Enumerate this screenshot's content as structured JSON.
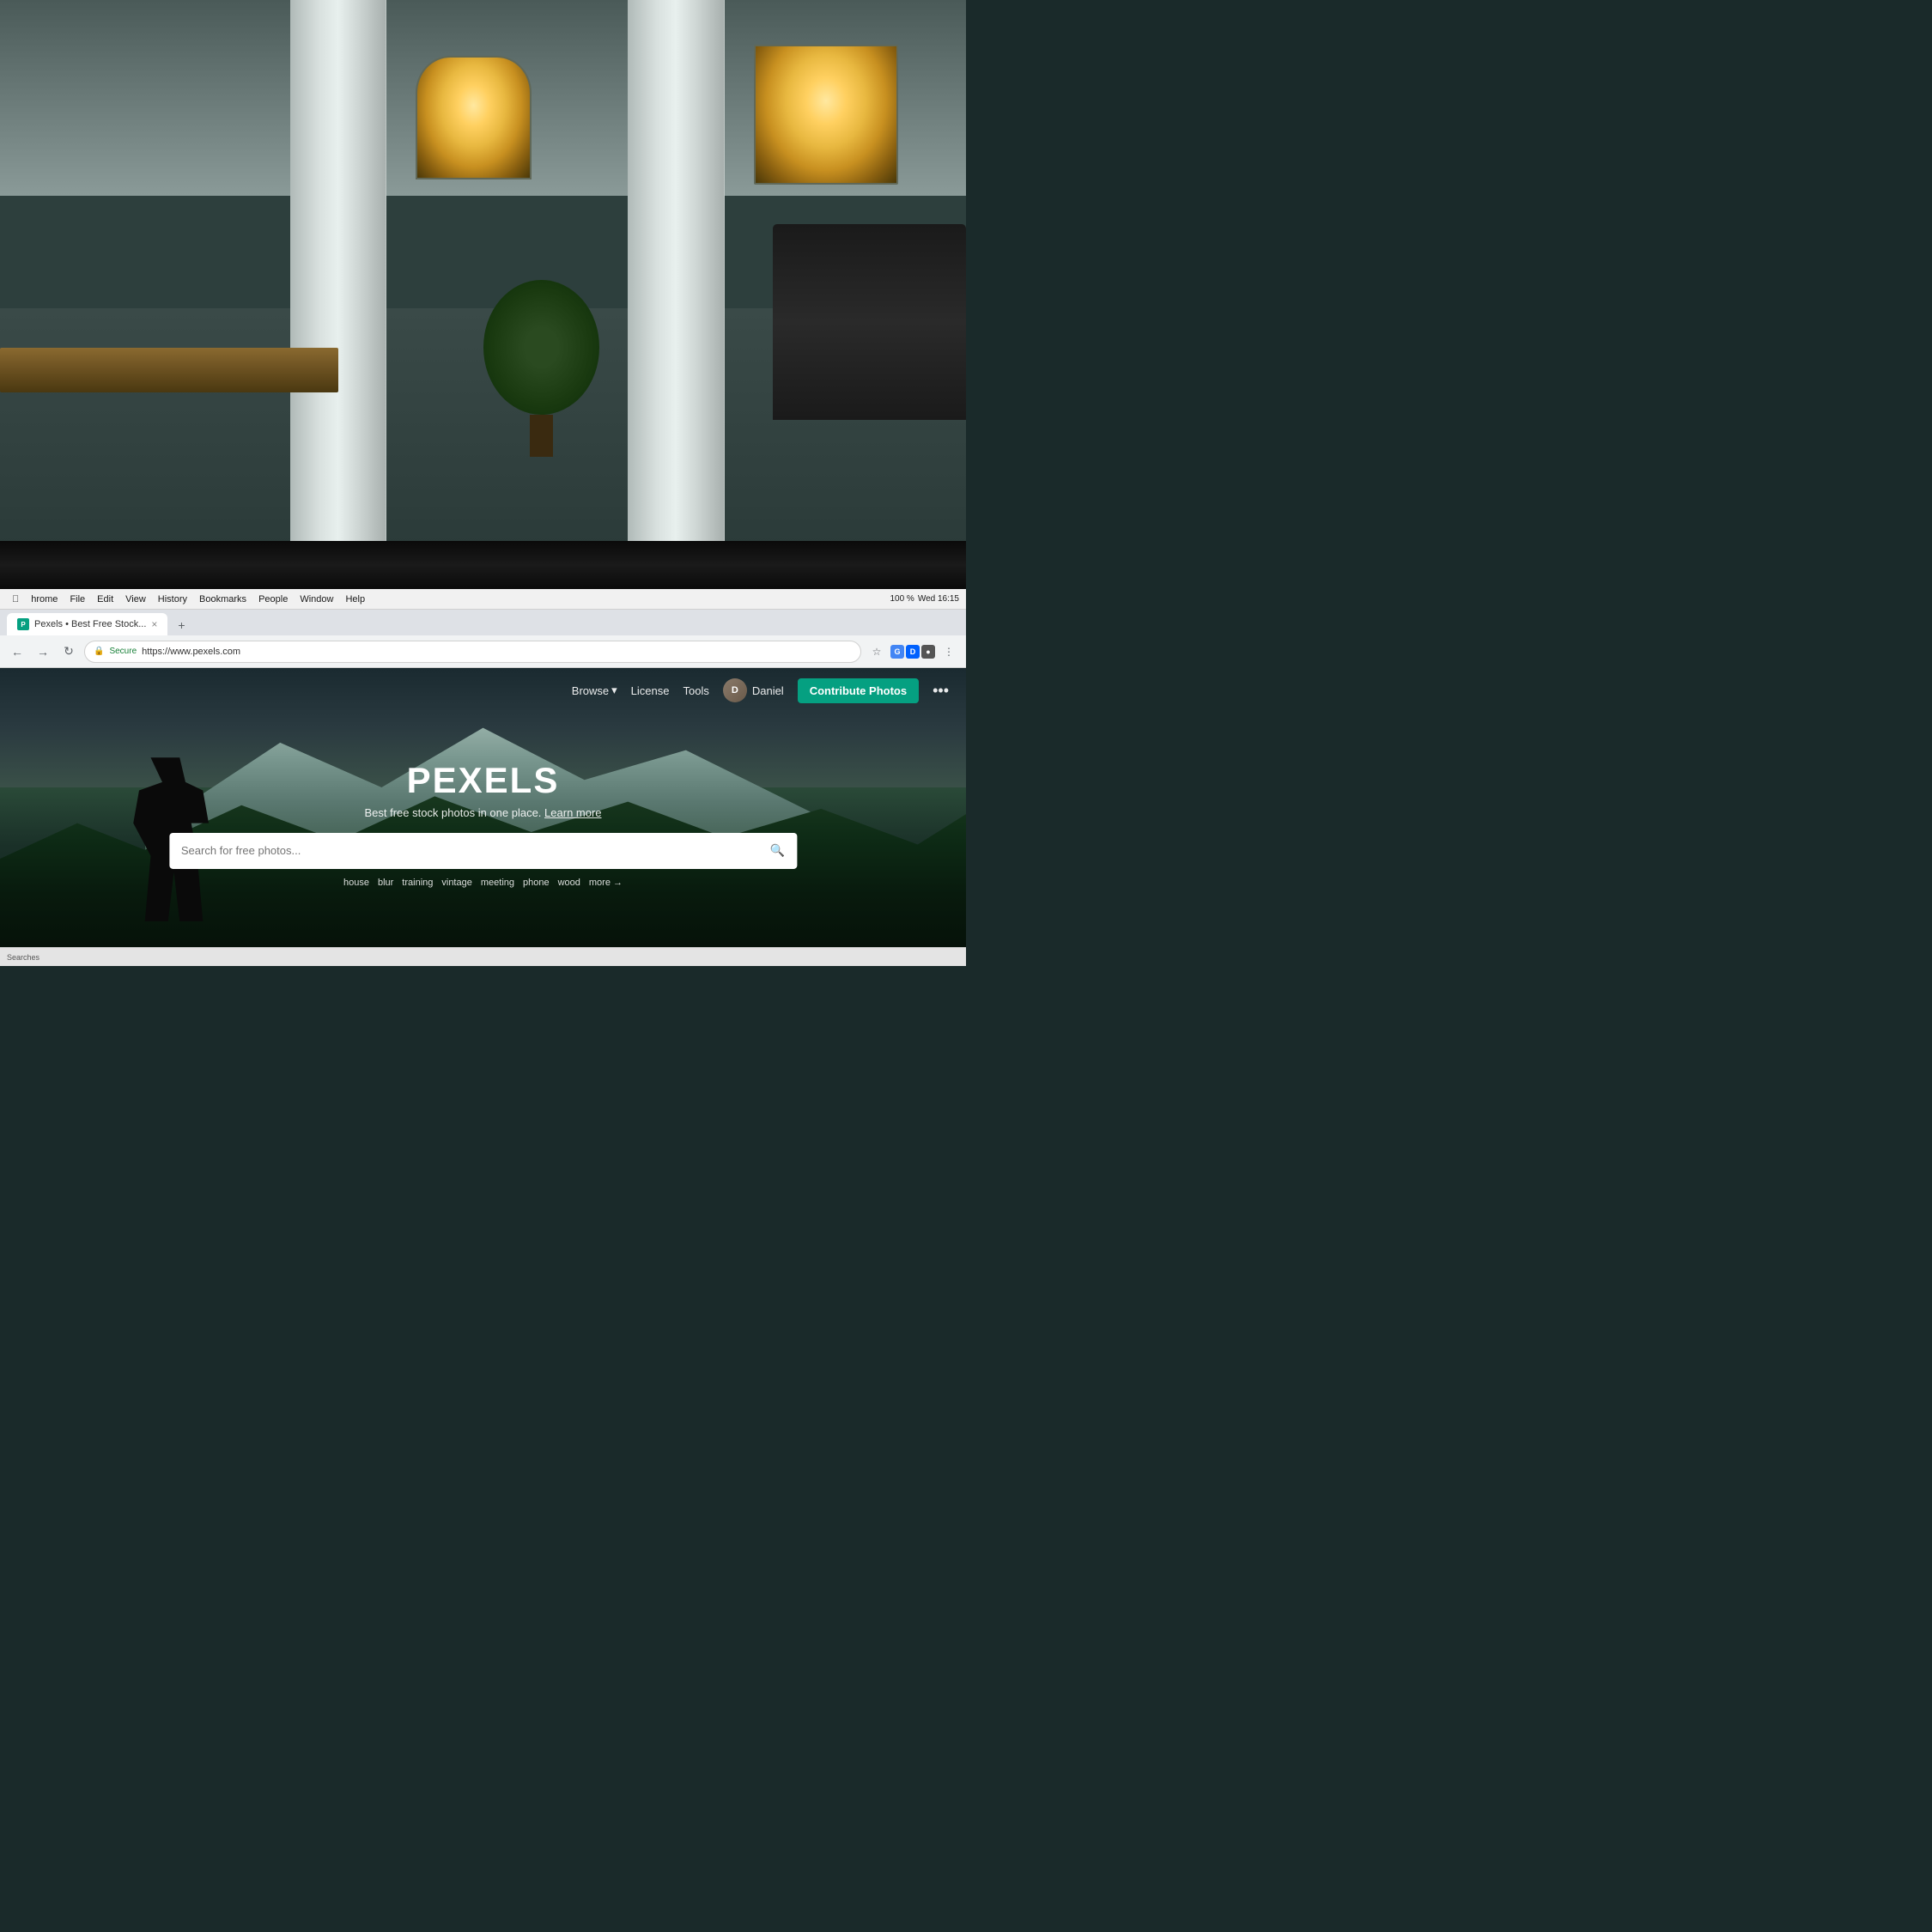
{
  "office_bg": {
    "description": "Office interior background photo"
  },
  "mac_menu": {
    "items": [
      "hrome",
      "File",
      "Edit",
      "View",
      "History",
      "Bookmarks",
      "People",
      "Window",
      "Help"
    ],
    "system": "Wed 16:15",
    "battery": "100 %"
  },
  "chrome": {
    "tab_label": "Pexels • Best Free Stock...",
    "tab_favicon": "P",
    "nav": {
      "back_icon": "←",
      "forward_icon": "→",
      "refresh_icon": "↻"
    },
    "address": {
      "secure_label": "Secure",
      "url": "https://www.pexels.com"
    },
    "bookmark_icon": "☆",
    "more_icon": "⋮"
  },
  "pexels": {
    "nav": {
      "browse_label": "Browse",
      "browse_arrow": "▾",
      "license_label": "License",
      "tools_label": "Tools",
      "user_initial": "D",
      "username": "Daniel",
      "contribute_label": "Contribute Photos",
      "more_label": "•••"
    },
    "hero": {
      "logo": "PEXELS",
      "tagline": "Best free stock photos in one place.",
      "learn_more": "Learn more",
      "search_placeholder": "Search for free photos...",
      "search_icon": "🔍",
      "suggestions": [
        "house",
        "blur",
        "training",
        "vintage",
        "meeting",
        "phone",
        "wood",
        "more →"
      ]
    }
  },
  "status_bar": {
    "label": "Searches"
  }
}
